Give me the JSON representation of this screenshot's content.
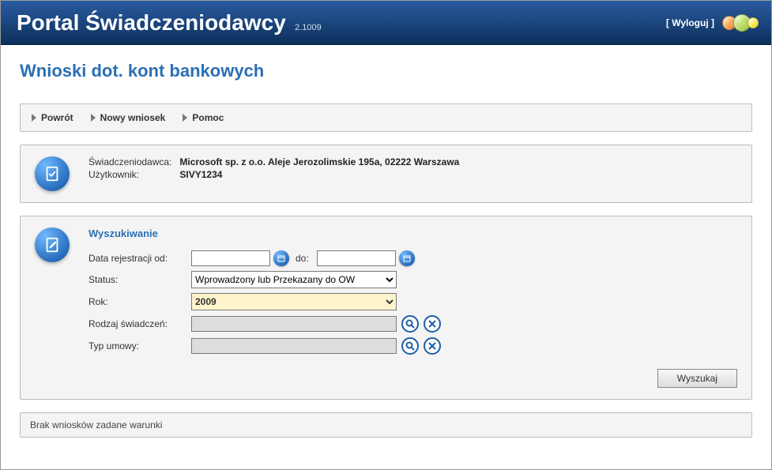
{
  "header": {
    "title": "Portal Świadczeniodawcy",
    "version": "2.1009",
    "logout_label": "[ Wyloguj ]"
  },
  "page_heading": "Wnioski dot. kont bankowych",
  "nav": {
    "items": [
      {
        "label": "Powrót"
      },
      {
        "label": "Nowy wniosek"
      },
      {
        "label": "Pomoc"
      }
    ]
  },
  "info": {
    "provider_label": "Świadczeniodawca:",
    "provider_value": "Microsoft sp. z o.o. Aleje Jerozolimskie 195a, 02222 Warszawa",
    "user_label": "Użytkownik:",
    "user_value": "SIVY1234"
  },
  "search": {
    "title": "Wyszukiwanie",
    "date_from_label": "Data rejestracji od:",
    "date_to_label": "do:",
    "date_from_value": "",
    "date_to_value": "",
    "status_label": "Status:",
    "status_value": "Wprowadzony lub Przekazany do OW",
    "year_label": "Rok:",
    "year_value": "2009",
    "benefit_type_label": "Rodzaj świadczeń:",
    "benefit_type_value": "",
    "contract_type_label": "Typ umowy:",
    "contract_type_value": "",
    "submit_label": "Wyszukaj"
  },
  "results": {
    "empty_message": "Brak wniosków zadane warunki"
  }
}
